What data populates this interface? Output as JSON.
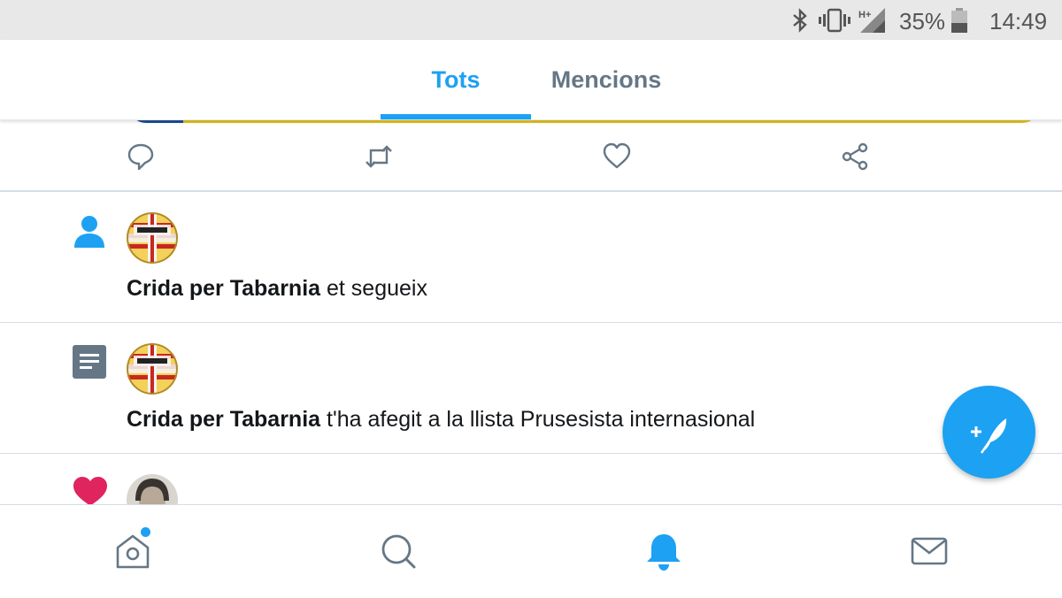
{
  "status_bar": {
    "icons": [
      "bluetooth-icon",
      "vibrate-icon",
      "signal-h-plus-icon",
      "battery-icon"
    ],
    "network": "H+",
    "battery_percent": "35%",
    "clock": "14:49"
  },
  "tabs": [
    {
      "label": "Tots",
      "active": true
    },
    {
      "label": "Mencions",
      "active": false
    }
  ],
  "tweet_actions": [
    "reply-icon",
    "retweet-icon",
    "like-icon",
    "share-icon"
  ],
  "notifications": [
    {
      "type_icon": "person-icon",
      "avatar": "Visca Tabarnia logo",
      "actor": "Crida per Tabarnia",
      "action": " et segueix"
    },
    {
      "type_icon": "list-icon",
      "avatar": "Visca Tabarnia logo",
      "actor": "Crida per Tabarnia",
      "action": " t'ha afegit a la llista Prusesista internasional"
    },
    {
      "type_icon": "heart-icon",
      "avatar": "user photo"
    }
  ],
  "fab": {
    "icon": "compose-tweet-icon"
  },
  "bottom_nav": [
    {
      "name": "home-icon",
      "active": false,
      "has_dot": true
    },
    {
      "name": "search-icon",
      "active": false
    },
    {
      "name": "notifications-bell-icon",
      "active": true
    },
    {
      "name": "messages-icon",
      "active": false
    }
  ],
  "colors": {
    "accent": "#1da1f2",
    "inactive": "#657786",
    "heart": "#e0245e",
    "divider": "#d5dde4"
  }
}
